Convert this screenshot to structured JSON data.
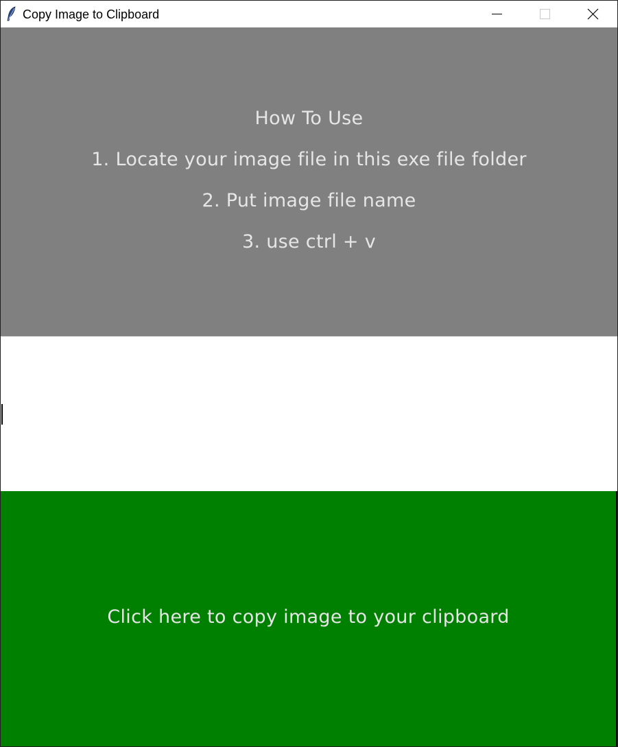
{
  "window": {
    "title": "Copy Image to Clipboard",
    "icon": "feather-icon",
    "controls": {
      "minimize": "minimize-icon",
      "maximize": "maximize-icon",
      "close": "close-icon"
    }
  },
  "instructions": {
    "lines": [
      "How To Use",
      "1. Locate your image file in this exe file folder",
      "2. Put image file name",
      "3. use ctrl + v"
    ],
    "background": "#808080",
    "text_color": "#e6e6e6"
  },
  "entry": {
    "value": "",
    "background": "#ffffff"
  },
  "copy_button": {
    "label": "Click here to copy image to your clipboard",
    "background": "#008000",
    "text_color": "#e6e6e6"
  }
}
